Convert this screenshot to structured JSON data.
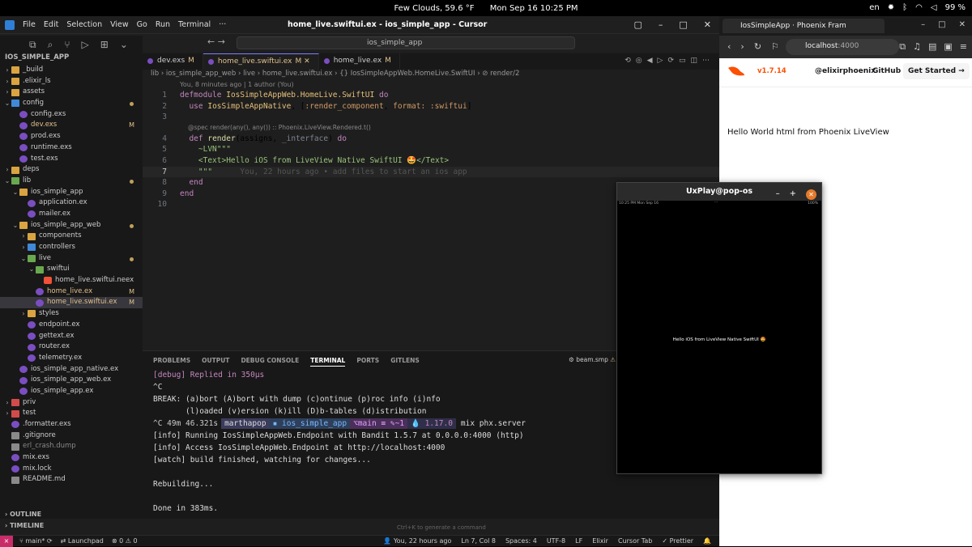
{
  "topbar": {
    "weather": "Few Clouds, 59.6 °F",
    "datetime": "Mon Sep 16  10:25 PM",
    "lang": "en",
    "battery": "99 %"
  },
  "editor": {
    "title": "home_live.swiftui.ex - ios_simple_app - Cursor",
    "menu": [
      "File",
      "Edit",
      "Selection",
      "View",
      "Go",
      "Run",
      "Terminal",
      "···"
    ],
    "search": "ios_simple_app",
    "tabs": [
      {
        "label": "dev.exs",
        "badge": "M"
      },
      {
        "label": "home_live.swiftui.ex",
        "badge": "M"
      },
      {
        "label": "home_live.ex",
        "badge": "M"
      }
    ],
    "breadcrumb": "lib  ›  ios_simple_app_web  ›  live  ›  home_live.swiftui.ex  ›  {} IosSimpleAppWeb.HomeLive.SwiftUI  ›  ⊘ render/2",
    "blame": "You, 8 minutes ago | 1 author (You)",
    "spec": "@spec render(any(), any()) :: Phoenix.LiveView.Rendered.t()",
    "ghost": "You, 22 hours ago • add files to start an ios app",
    "code": [
      [
        "1",
        "defmodule IosSimpleAppWeb.HomeLive.SwiftUI do"
      ],
      [
        "2",
        "  use IosSimpleAppNative, [:render_component, format: :swiftui]"
      ],
      [
        "3",
        ""
      ],
      [
        "4",
        "  def render(assigns, _interface) do"
      ],
      [
        "5",
        "    ~LVN\"\"\""
      ],
      [
        "6",
        "    <Text>Hello iOS from LiveView Native SwiftUI 🤩</Text>"
      ],
      [
        "7",
        "    \"\"\""
      ],
      [
        "8",
        "  end"
      ],
      [
        "9",
        "end"
      ],
      [
        "10",
        ""
      ]
    ]
  },
  "explorer": {
    "root": "IOS_SIMPLE_APP",
    "items": [
      {
        "label": "_build",
        "depth": 0,
        "type": "folder",
        "open": false
      },
      {
        "label": ".elixir_ls",
        "depth": 0,
        "type": "folder",
        "open": false
      },
      {
        "label": "assets",
        "depth": 0,
        "type": "folder",
        "open": false
      },
      {
        "label": "config",
        "depth": 0,
        "type": "folder",
        "open": true,
        "dot": true
      },
      {
        "label": "config.exs",
        "depth": 1,
        "type": "ex"
      },
      {
        "label": "dev.exs",
        "depth": 1,
        "type": "ex",
        "mod": "M"
      },
      {
        "label": "prod.exs",
        "depth": 1,
        "type": "ex"
      },
      {
        "label": "runtime.exs",
        "depth": 1,
        "type": "ex"
      },
      {
        "label": "test.exs",
        "depth": 1,
        "type": "ex"
      },
      {
        "label": "deps",
        "depth": 0,
        "type": "folder",
        "open": false
      },
      {
        "label": "lib",
        "depth": 0,
        "type": "folder",
        "open": true,
        "dot": true
      },
      {
        "label": "ios_simple_app",
        "depth": 1,
        "type": "folder",
        "open": true
      },
      {
        "label": "application.ex",
        "depth": 2,
        "type": "ex"
      },
      {
        "label": "mailer.ex",
        "depth": 2,
        "type": "ex"
      },
      {
        "label": "ios_simple_app_web",
        "depth": 1,
        "type": "folder",
        "open": true,
        "dot": true
      },
      {
        "label": "components",
        "depth": 2,
        "type": "folder",
        "open": false
      },
      {
        "label": "controllers",
        "depth": 2,
        "type": "folder",
        "open": false
      },
      {
        "label": "live",
        "depth": 2,
        "type": "folder",
        "open": true,
        "dot": true
      },
      {
        "label": "swiftui",
        "depth": 3,
        "type": "folder",
        "open": true
      },
      {
        "label": "home_live.swiftui.neex",
        "depth": 4,
        "type": "swift"
      },
      {
        "label": "home_live.ex",
        "depth": 3,
        "type": "ex",
        "mod": "M"
      },
      {
        "label": "home_live.swiftui.ex",
        "depth": 3,
        "type": "ex",
        "mod": "M",
        "active": true
      },
      {
        "label": "styles",
        "depth": 2,
        "type": "folder",
        "open": false
      },
      {
        "label": "endpoint.ex",
        "depth": 2,
        "type": "ex"
      },
      {
        "label": "gettext.ex",
        "depth": 2,
        "type": "ex"
      },
      {
        "label": "router.ex",
        "depth": 2,
        "type": "ex"
      },
      {
        "label": "telemetry.ex",
        "depth": 2,
        "type": "ex"
      },
      {
        "label": "ios_simple_app_native.ex",
        "depth": 1,
        "type": "ex"
      },
      {
        "label": "ios_simple_app_web.ex",
        "depth": 1,
        "type": "ex"
      },
      {
        "label": "ios_simple_app.ex",
        "depth": 1,
        "type": "ex"
      },
      {
        "label": "priv",
        "depth": 0,
        "type": "folder",
        "open": false
      },
      {
        "label": "test",
        "depth": 0,
        "type": "folder",
        "open": false
      },
      {
        "label": ".formatter.exs",
        "depth": 0,
        "type": "ex"
      },
      {
        "label": ".gitignore",
        "depth": 0,
        "type": "gen"
      },
      {
        "label": "erl_crash.dump",
        "depth": 0,
        "type": "gen",
        "dim": true
      },
      {
        "label": "mix.exs",
        "depth": 0,
        "type": "ex"
      },
      {
        "label": "mix.lock",
        "depth": 0,
        "type": "ex"
      },
      {
        "label": "README.md",
        "depth": 0,
        "type": "gen"
      }
    ],
    "outline": "OUTLINE",
    "timeline": "TIMELINE"
  },
  "panel": {
    "tabs": [
      "PROBLEMS",
      "OUTPUT",
      "DEBUG CONSOLE",
      "TERMINAL",
      "PORTS",
      "GITLENS"
    ],
    "active": "TERMINAL",
    "task": "beam.smp",
    "lines1": [
      "[debug] Replied in 350µs",
      "^C",
      "BREAK: (a)bort (A)bort with dump (c)ontinue (p)roc info (i)nfo",
      "       (l)oaded (v)ersion (k)ill (D)b-tables (d)istribution"
    ],
    "prompt": {
      "time": "^C 49m 46.321s",
      "user": "marthapop",
      "dir": "ios_simple_app",
      "git": "main ≡ ✎~1",
      "elixir": "1.17.0",
      "cmd": "mix phx.server"
    },
    "lines2": [
      "[info] Running IosSimpleAppWeb.Endpoint with Bandit 1.5.7 at 0.0.0.0:4000 (http)",
      "[info] Access IosSimpleAppWeb.Endpoint at http://localhost:4000",
      "[watch] build finished, watching for changes...",
      "",
      "Rebuilding...",
      "",
      "Done in 383ms."
    ],
    "hint": "Ctrl+K to generate a command"
  },
  "statusbar": {
    "branch": "main*",
    "launchpad": "Launchpad",
    "problems": "⊗ 0 ⚠ 0",
    "blame": "You, 22 hours ago",
    "pos": "Ln 7, Col 8",
    "spaces": "Spaces: 4",
    "enc": "UTF-8",
    "eol": "LF",
    "lang": "Elixir",
    "tab": "Cursor Tab",
    "prettier": "✓ Prettier"
  },
  "browser": {
    "tab": "IosSimpleApp · Phoenix Fram",
    "host": "localhost",
    "port": ":4000",
    "version": "v1.7.14",
    "handle": "@elixirphoenix",
    "github": "GitHub",
    "get_started": "Get Started →",
    "hello": "Hello World html from Phoenix LiveView"
  },
  "uxplay": {
    "title": "UxPlay@pop-os",
    "status_left": "10:25 PM  Mon Sep 16",
    "status_mid": "···",
    "status_right": "100%",
    "hello": "Hello iOS from LiveView Native SwiftUI 🤩"
  }
}
